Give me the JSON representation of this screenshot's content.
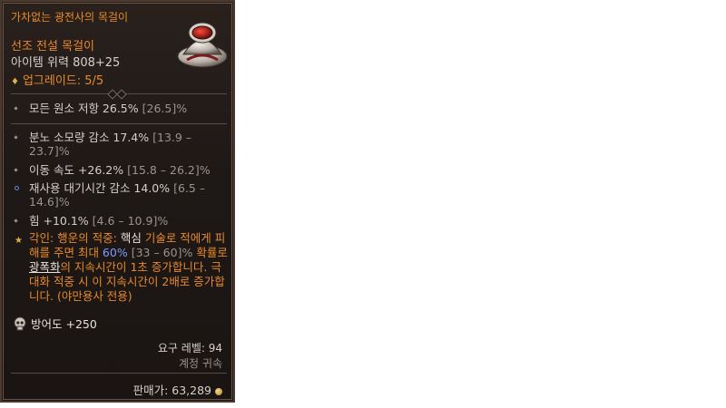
{
  "item": {
    "name": "가차없는 광전사의 목걸이",
    "type": "선조 전설 목걸이",
    "power": "아이템 위력 808+25",
    "upgrade": "업그레이드: 5/5"
  },
  "stats": {
    "resist": {
      "label": "모든 원소 저항 26.5%",
      "range": "[26.5]%"
    },
    "fury": {
      "label": "분노 소모량 감소 17.4%",
      "range": "[13.9 – 23.7]%"
    },
    "speed": {
      "label": "이동 속도 +26.2%",
      "range": "[15.8 – 26.2]%"
    },
    "cdr": {
      "label": "재사용 대기시간 감소 14.0%",
      "range": "[6.5 – 14.6]%"
    },
    "str": {
      "label": "힘 +10.1%",
      "range": "[4.6 – 10.9]%"
    }
  },
  "aspect": {
    "part1": "각인: 행운의 적중: ",
    "core": "핵심",
    "part2": " 기술로 적에게 피해를 주면 최대 ",
    "chance": "60%",
    "range": " [33 – 60]%",
    "part3": " 확률로 ",
    "skill": "광폭화",
    "part4": "의 지속시간이 1초 증가합니다. 극대화 적중 시 이 지속시간이 2배로 증가합니다. (야만용사 전용)"
  },
  "armor": "방어도 +250",
  "requirement": "요구 레벨: 94",
  "binding": "계정 귀속",
  "sell_price": "판매가: 63,289",
  "icons": {
    "item": "necklace-icon",
    "armor": "skull-icon",
    "currency": "gold-coin-icon"
  },
  "colors": {
    "legendary": "#e88a2c",
    "text": "#d6d0c8",
    "range": "#9a948c",
    "highlight": "#7f9bff"
  }
}
